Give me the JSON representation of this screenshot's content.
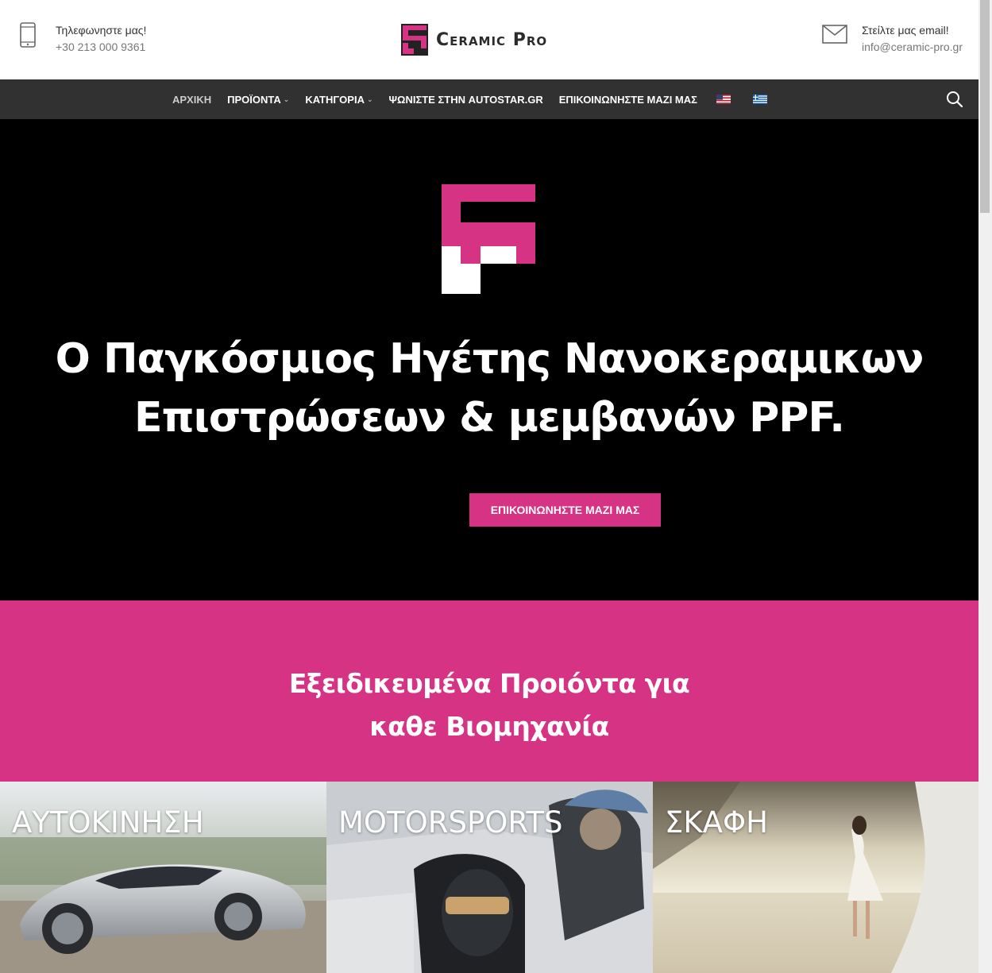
{
  "header": {
    "phone_label": "Τηλεφωνηστε μας!",
    "phone_value": "+30 213 000 9361",
    "email_label": "Στείλτε μας email!",
    "email_value": "info@ceramic-pro.gr",
    "logo_text": "Ceramic Pro"
  },
  "nav": {
    "items": [
      {
        "label": "ΑΡΧΙΚΗ"
      },
      {
        "label": "ΠΡΟΪΟΝΤΑ"
      },
      {
        "label": "ΚΑΤΗΓΟΡΙΑ"
      },
      {
        "label": "ΨΩΝΙΣΤΕ ΣΤΗΝ AUTOSTAR.GR"
      },
      {
        "label": "ΕΠΙΚΟΙΝΩΝΗΣΤΕ ΜΑΖΙ ΜΑΣ"
      }
    ]
  },
  "hero": {
    "title_line1": "Ο Παγκόσμιος Ηγέτης Νανοκεραμικων",
    "title_line2": "Επιστρώσεων & μεμβανών PPF.",
    "button_label": "ΕΠΙΚΟΙΝΩΝΗΣΤΕ ΜΑΖΙ ΜΑΣ"
  },
  "industries": {
    "title_line1": "Εξειδικευμένα Προιόντα για",
    "title_line2": "καθε Βιομηχανία",
    "tiles": [
      {
        "label": "ΑΥΤΟΚΙΝΗΣΗ"
      },
      {
        "label": "MOTORSPORTS"
      },
      {
        "label": "ΣΚΑΦΗ"
      }
    ]
  },
  "colors": {
    "brand_pink": "#d63384",
    "nav_bg": "#313131",
    "hero_bg": "#000000"
  }
}
